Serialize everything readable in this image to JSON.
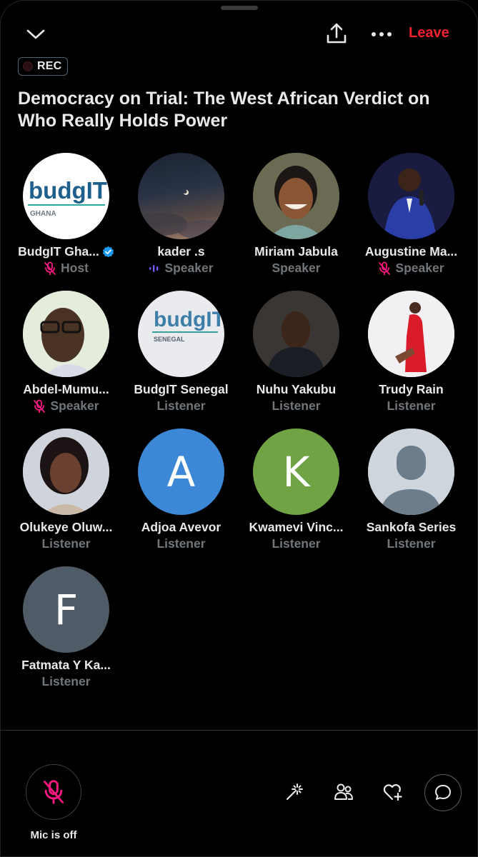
{
  "header": {
    "leave_label": "Leave",
    "collapse_icon": "chevron-down-icon",
    "share_icon": "share-icon",
    "more_icon": "more-icon"
  },
  "rec_badge": {
    "label": "REC"
  },
  "space": {
    "title": "Democracy on Trial: The West African Verdict on Who Really Holds Power"
  },
  "participants": [
    {
      "name": "BudgIT Gha...",
      "role": "Host",
      "verified": true,
      "role_icon": "mic-off-icon",
      "avatar": "budgit-ghana-logo"
    },
    {
      "name": "kader .s",
      "role": "Speaker",
      "role_icon": "speaking-icon",
      "avatar": "night-sky-photo"
    },
    {
      "name": "Miriam Jabula",
      "role": "Speaker",
      "avatar": "user-photo"
    },
    {
      "name": "Augustine Ma...",
      "role": "Speaker",
      "role_icon": "mic-off-icon",
      "avatar": "user-photo"
    },
    {
      "name": "Abdel-Mumu...",
      "role": "Speaker",
      "role_icon": "mic-off-icon",
      "avatar": "user-photo"
    },
    {
      "name": "BudgIT Senegal",
      "role": "Listener",
      "avatar": "budgit-senegal-logo"
    },
    {
      "name": "Nuhu Yakubu",
      "role": "Listener",
      "avatar": "user-photo"
    },
    {
      "name": "Trudy Rain",
      "role": "Listener",
      "avatar": "user-photo"
    },
    {
      "name": "Olukeye Oluw...",
      "role": "Listener",
      "avatar": "user-photo"
    },
    {
      "name": "Adjoa Avevor",
      "role": "Listener",
      "avatar_letter": "A",
      "avatar_color": "#3d88d6"
    },
    {
      "name": "Kwamevi Vinc...",
      "role": "Listener",
      "avatar_letter": "K",
      "avatar_color": "#6fa343"
    },
    {
      "name": "Sankofa Series",
      "role": "Listener",
      "avatar": "default-avatar"
    },
    {
      "name": "Fatmata Y Ka...",
      "role": "Listener",
      "avatar_letter": "F",
      "avatar_color": "#4f5b66"
    }
  ],
  "logos": {
    "budgit_text": "budgIT",
    "ghana": "GHANA",
    "senegal": "SENEGAL"
  },
  "footer": {
    "mic_label": "Mic is off",
    "tools": [
      "effects-icon",
      "people-icon",
      "heart-plus-icon",
      "chat-icon"
    ]
  },
  "colors": {
    "accent_red": "#f4212e",
    "muted": "#71767b",
    "verified": "#1d9bf0",
    "speaking": "#7856ff",
    "mic_off": "#f91880"
  }
}
